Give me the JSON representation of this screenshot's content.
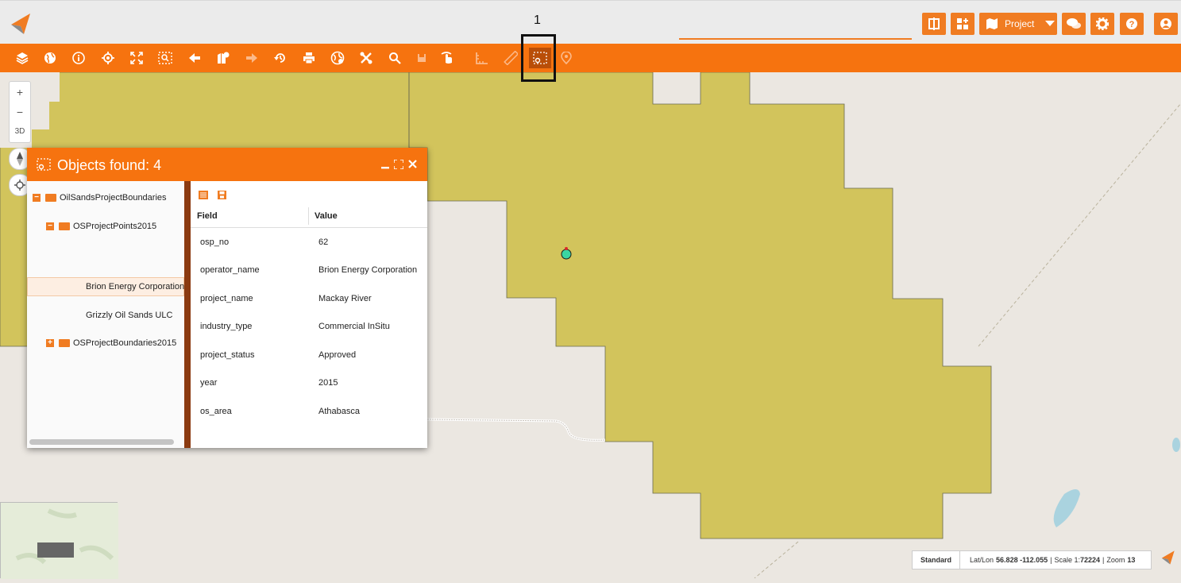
{
  "annotation": {
    "label": "1"
  },
  "header": {
    "project_label": "Project",
    "icons": [
      "compare-icon",
      "add-widget-icon",
      "map-icon",
      "chat-icon",
      "settings-icon",
      "help-icon",
      "user-icon"
    ]
  },
  "toolbar": {
    "tools": [
      "layers-icon",
      "globe-icon",
      "info-icon",
      "locate-icon",
      "fullscreen-icon",
      "zoom-selection-icon",
      "back-icon",
      "bookmark-icon",
      "forward-icon",
      "history-icon",
      "print-icon",
      "basemap-icon",
      "tools-icon",
      "search-icon",
      "save-icon",
      "touch-icon",
      "measure-area-icon",
      "measure-line-icon",
      "select-objects-icon",
      "location-pin-icon"
    ],
    "active_tool": "select-objects-icon"
  },
  "map_controls": {
    "zoom_in": "+",
    "zoom_out": "−",
    "three_d": "3D"
  },
  "dialog": {
    "title": "Objects found: 4",
    "tree": {
      "root": "OilSandsProjectBoundaries",
      "group1": "OSProjectPoints2015",
      "item1": "Brion Energy Corporation",
      "item2": "Grizzly Oil Sands ULC",
      "group2": "OSProjectBoundaries2015"
    },
    "table": {
      "col_field": "Field",
      "col_value": "Value",
      "rows": [
        {
          "field": "osp_no",
          "value": "62"
        },
        {
          "field": "operator_name",
          "value": "Brion Energy Corporation"
        },
        {
          "field": "project_name",
          "value": "Mackay River"
        },
        {
          "field": "industry_type",
          "value": "Commercial InSitu"
        },
        {
          "field": "project_status",
          "value": "Approved"
        },
        {
          "field": "year",
          "value": "2015"
        },
        {
          "field": "os_area",
          "value": "Athabasca"
        }
      ]
    }
  },
  "status": {
    "basemap": "Standard",
    "latlon_label": "Lat/Lon",
    "latlon_value": "56.828 -112.055",
    "scale_label": "Scale 1:",
    "scale_value": "72224",
    "zoom_label": "Zoom",
    "zoom_value": "13"
  },
  "colors": {
    "accent": "#f6730f",
    "polygon_fill": "#d2c45c",
    "map_bg": "#ebe7e1",
    "splitter": "#8b3a10"
  }
}
